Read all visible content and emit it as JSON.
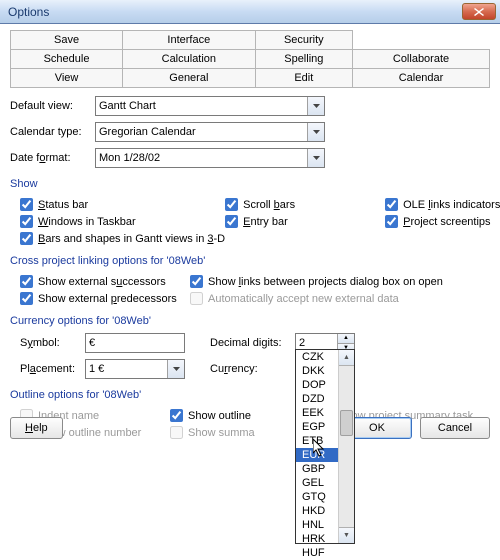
{
  "window": {
    "title": "Options"
  },
  "tabs": {
    "row1": [
      "Save",
      "Interface",
      "Security",
      ""
    ],
    "row2": [
      "Schedule",
      "Calculation",
      "Spelling",
      "Collaborate"
    ],
    "row3": [
      "View",
      "General",
      "Edit",
      "Calendar"
    ]
  },
  "view": {
    "default_view_label": "Default view:",
    "default_view_value": "Gantt Chart",
    "calendar_type_label": "Calendar type:",
    "calendar_type_value": "Gregorian Calendar",
    "date_format_label": "Date format:",
    "date_format_value": "Mon 1/28/02"
  },
  "show": {
    "title": "Show",
    "status_bar": "Status bar",
    "windows_taskbar": "Windows in Taskbar",
    "bars_shapes": "Bars and shapes in Gantt views in 3-D",
    "scroll_bars": "Scroll bars",
    "entry_bar": "Entry bar",
    "ole_links": "OLE links indicators",
    "project_screentips": "Project screentips"
  },
  "cross": {
    "title": "Cross project linking options for '08Web'",
    "show_ext_succ": "Show external successors",
    "show_ext_pred": "Show external predecessors",
    "show_links_dialog": "Show links between projects dialog box on open",
    "auto_accept": "Automatically accept new external data"
  },
  "currency": {
    "title": "Currency options for '08Web'",
    "symbol_label": "Symbol:",
    "symbol_value": "€",
    "placement_label": "Placement:",
    "placement_value": "1 €",
    "decimal_label": "Decimal digits:",
    "decimal_value": "2",
    "currency_label": "Currency:",
    "currency_value": "EUR",
    "dropdown": [
      "CZK",
      "DKK",
      "DOP",
      "DZD",
      "EEK",
      "EGP",
      "ETB",
      "EUR",
      "GBP",
      "GEL",
      "GTQ",
      "HKD",
      "HNL",
      "HRK",
      "HUF"
    ],
    "dropdown_selected": "EUR"
  },
  "outline": {
    "title": "Outline options for '08Web'",
    "indent_name": "Indent name",
    "show_outline_number": "Show outline number",
    "show_outline": "Show outline",
    "show_summa": "Show summa",
    "show_project_summary": "Show project summary task"
  },
  "buttons": {
    "help": "Help",
    "ok": "OK",
    "cancel": "Cancel"
  }
}
